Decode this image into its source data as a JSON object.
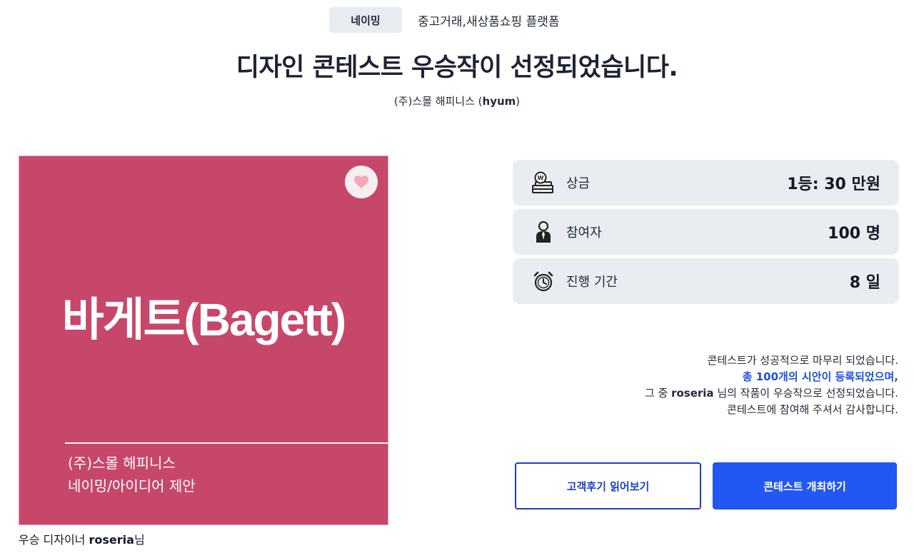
{
  "header": {
    "category_badge": "네이밍",
    "category_desc": "중고거래,새상품쇼핑 플랫폼",
    "title": "디자인 콘테스트 우승작이 선정되었습니다.",
    "company_prefix": "(주)스몰 해피니스 (",
    "company_user": "hyum",
    "company_suffix": ")"
  },
  "winner_card": {
    "name": "바게트(Bagett)",
    "company": "(주)스몰 해피니스",
    "subtitle": "네이밍/아이디어 제안",
    "heart_icon": "heart-icon",
    "background_color": "#c7476b"
  },
  "winner_caption": {
    "prefix": "우승 디자이너 ",
    "designer": "roseria",
    "suffix": "님"
  },
  "stats": [
    {
      "icon": "money-stack-icon",
      "label": "상금",
      "value": "1등: 30 만원"
    },
    {
      "icon": "person-icon",
      "label": "참여자",
      "value": "100 명"
    },
    {
      "icon": "alarm-clock-icon",
      "label": "진행 기간",
      "value": "8 일"
    }
  ],
  "result_message": {
    "line1": "콘테스트가 성공적으로 마무리 되었습니다.",
    "line2": "총 100개의 시안이 등록되었으며,",
    "line3_prefix": "그 중 ",
    "line3_designer": "roseria",
    "line3_suffix": " 님의 작품이 우승작으로 선정되었습니다.",
    "line4": "콘테스트에 참여해 주셔서 감사합니다."
  },
  "buttons": {
    "reviews": "고객후기 읽어보기",
    "host": "콘테스트 개최하기"
  },
  "colors": {
    "accent_blue": "#2157f2",
    "highlight_text": "#1d4fd8",
    "stat_background": "#e9edf1"
  }
}
